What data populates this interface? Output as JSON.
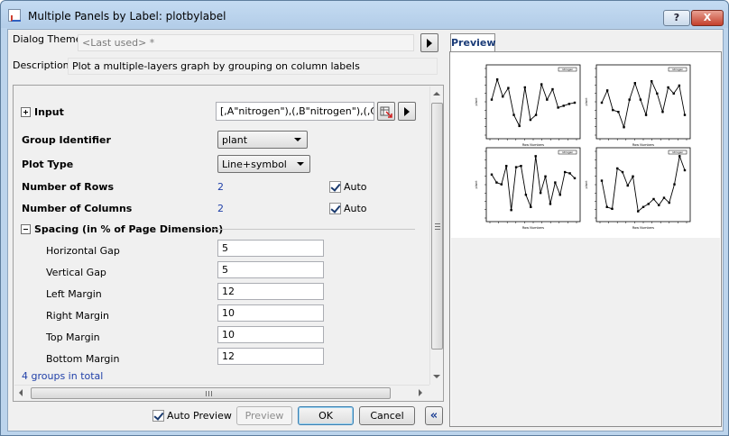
{
  "window": {
    "title": "Multiple Panels by Label: plotbylabel",
    "help_button": "?",
    "close_button": "X"
  },
  "header": {
    "dialog_theme_label": "Dialog Theme",
    "dialog_theme_value": "<Last used> *",
    "description_label": "Description",
    "description_value": "Plot a multiple-layers graph by grouping on column labels"
  },
  "settings": {
    "input_label": "Input",
    "input_value": "[,A\"nitrogen\"),(,B\"nitrogen\"),(,C\"nitrc",
    "group_identifier_label": "Group Identifier",
    "group_identifier_value": "plant",
    "plot_type_label": "Plot Type",
    "plot_type_value": "Line+symbol",
    "rows_label": "Number of Rows",
    "rows_value": "2",
    "rows_auto_label": "Auto",
    "rows_auto_checked": true,
    "columns_label": "Number of Columns",
    "columns_value": "2",
    "columns_auto_label": "Auto",
    "columns_auto_checked": true,
    "spacing_label": "Spacing (in % of Page Dimension)",
    "spacing": [
      {
        "label": "Horizontal Gap",
        "value": "5"
      },
      {
        "label": "Vertical Gap",
        "value": "5"
      },
      {
        "label": "Left Margin",
        "value": "12"
      },
      {
        "label": "Right Margin",
        "value": "10"
      },
      {
        "label": "Top Margin",
        "value": "10"
      },
      {
        "label": "Bottom Margin",
        "value": "12"
      }
    ],
    "status_text": "4 groups in total"
  },
  "footer": {
    "auto_preview_label": "Auto Preview",
    "auto_preview_checked": true,
    "preview_button": "Preview",
    "ok_button": "OK",
    "cancel_button": "Cancel",
    "collapse_button": "«"
  },
  "preview": {
    "tab_label": "Preview",
    "panels": [
      {
        "ylabel": "plant",
        "xlabel": "Row Numbers",
        "legend": "nitrogen",
        "values": [
          0.55,
          0.88,
          0.6,
          0.74,
          0.3,
          0.12,
          0.75,
          0.22,
          0.3,
          0.8,
          0.55,
          0.72,
          0.42,
          0.45,
          0.48,
          0.5
        ]
      },
      {
        "ylabel": "plant",
        "xlabel": "Row Numbers",
        "legend": "nitrogen",
        "values": [
          0.5,
          0.7,
          0.38,
          0.35,
          0.1,
          0.55,
          0.82,
          0.55,
          0.3,
          0.85,
          0.65,
          0.35,
          0.75,
          0.65,
          0.78,
          0.3
        ]
      },
      {
        "ylabel": "plant",
        "xlabel": "Row Numbers",
        "legend": "nitrogen",
        "values": [
          0.68,
          0.55,
          0.52,
          0.82,
          0.1,
          0.8,
          0.82,
          0.35,
          0.15,
          0.98,
          0.38,
          0.65,
          0.2,
          0.55,
          0.35,
          0.72,
          0.7,
          0.62
        ]
      },
      {
        "ylabel": "plant",
        "xlabel": "Row Numbers",
        "legend": "nitrogen",
        "values": [
          0.58,
          0.15,
          0.12,
          0.78,
          0.72,
          0.5,
          0.65,
          0.08,
          0.15,
          0.2,
          0.28,
          0.18,
          0.3,
          0.22,
          0.52,
          0.98,
          0.75
        ]
      }
    ]
  }
}
